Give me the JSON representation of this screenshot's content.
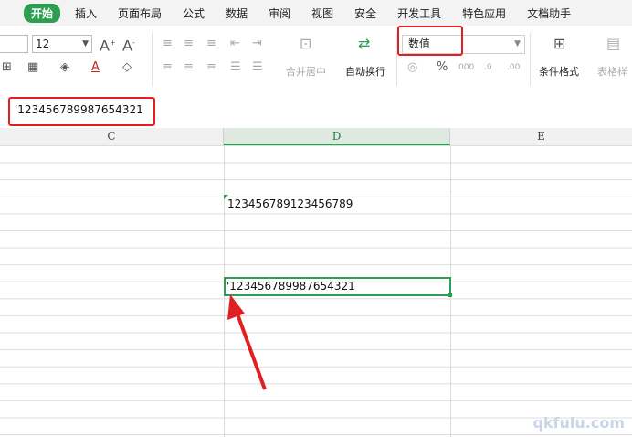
{
  "menu": {
    "items": [
      "开始",
      "插入",
      "页面布局",
      "公式",
      "数据",
      "审阅",
      "视图",
      "安全",
      "开发工具",
      "特色应用",
      "文档助手"
    ],
    "active_index": 0
  },
  "ribbon": {
    "font_size": "12",
    "font_color_icon": "A",
    "merge_label": "合并居中",
    "wrap_label": "自动换行",
    "number_format": "数值",
    "percent_icon": "%",
    "cond_format_label": "条件格式",
    "table_style_label": "表格样"
  },
  "formula_bar": {
    "content": "'123456789987654321"
  },
  "grid": {
    "columns": [
      "C",
      "D",
      "E"
    ],
    "selected_column": "D",
    "cells": {
      "d4": "123456789123456789",
      "d9": "'123456789987654321"
    }
  },
  "colors": {
    "accent": "#2e9e53",
    "highlight": "#e02020"
  },
  "watermark": "qkfulu.com"
}
